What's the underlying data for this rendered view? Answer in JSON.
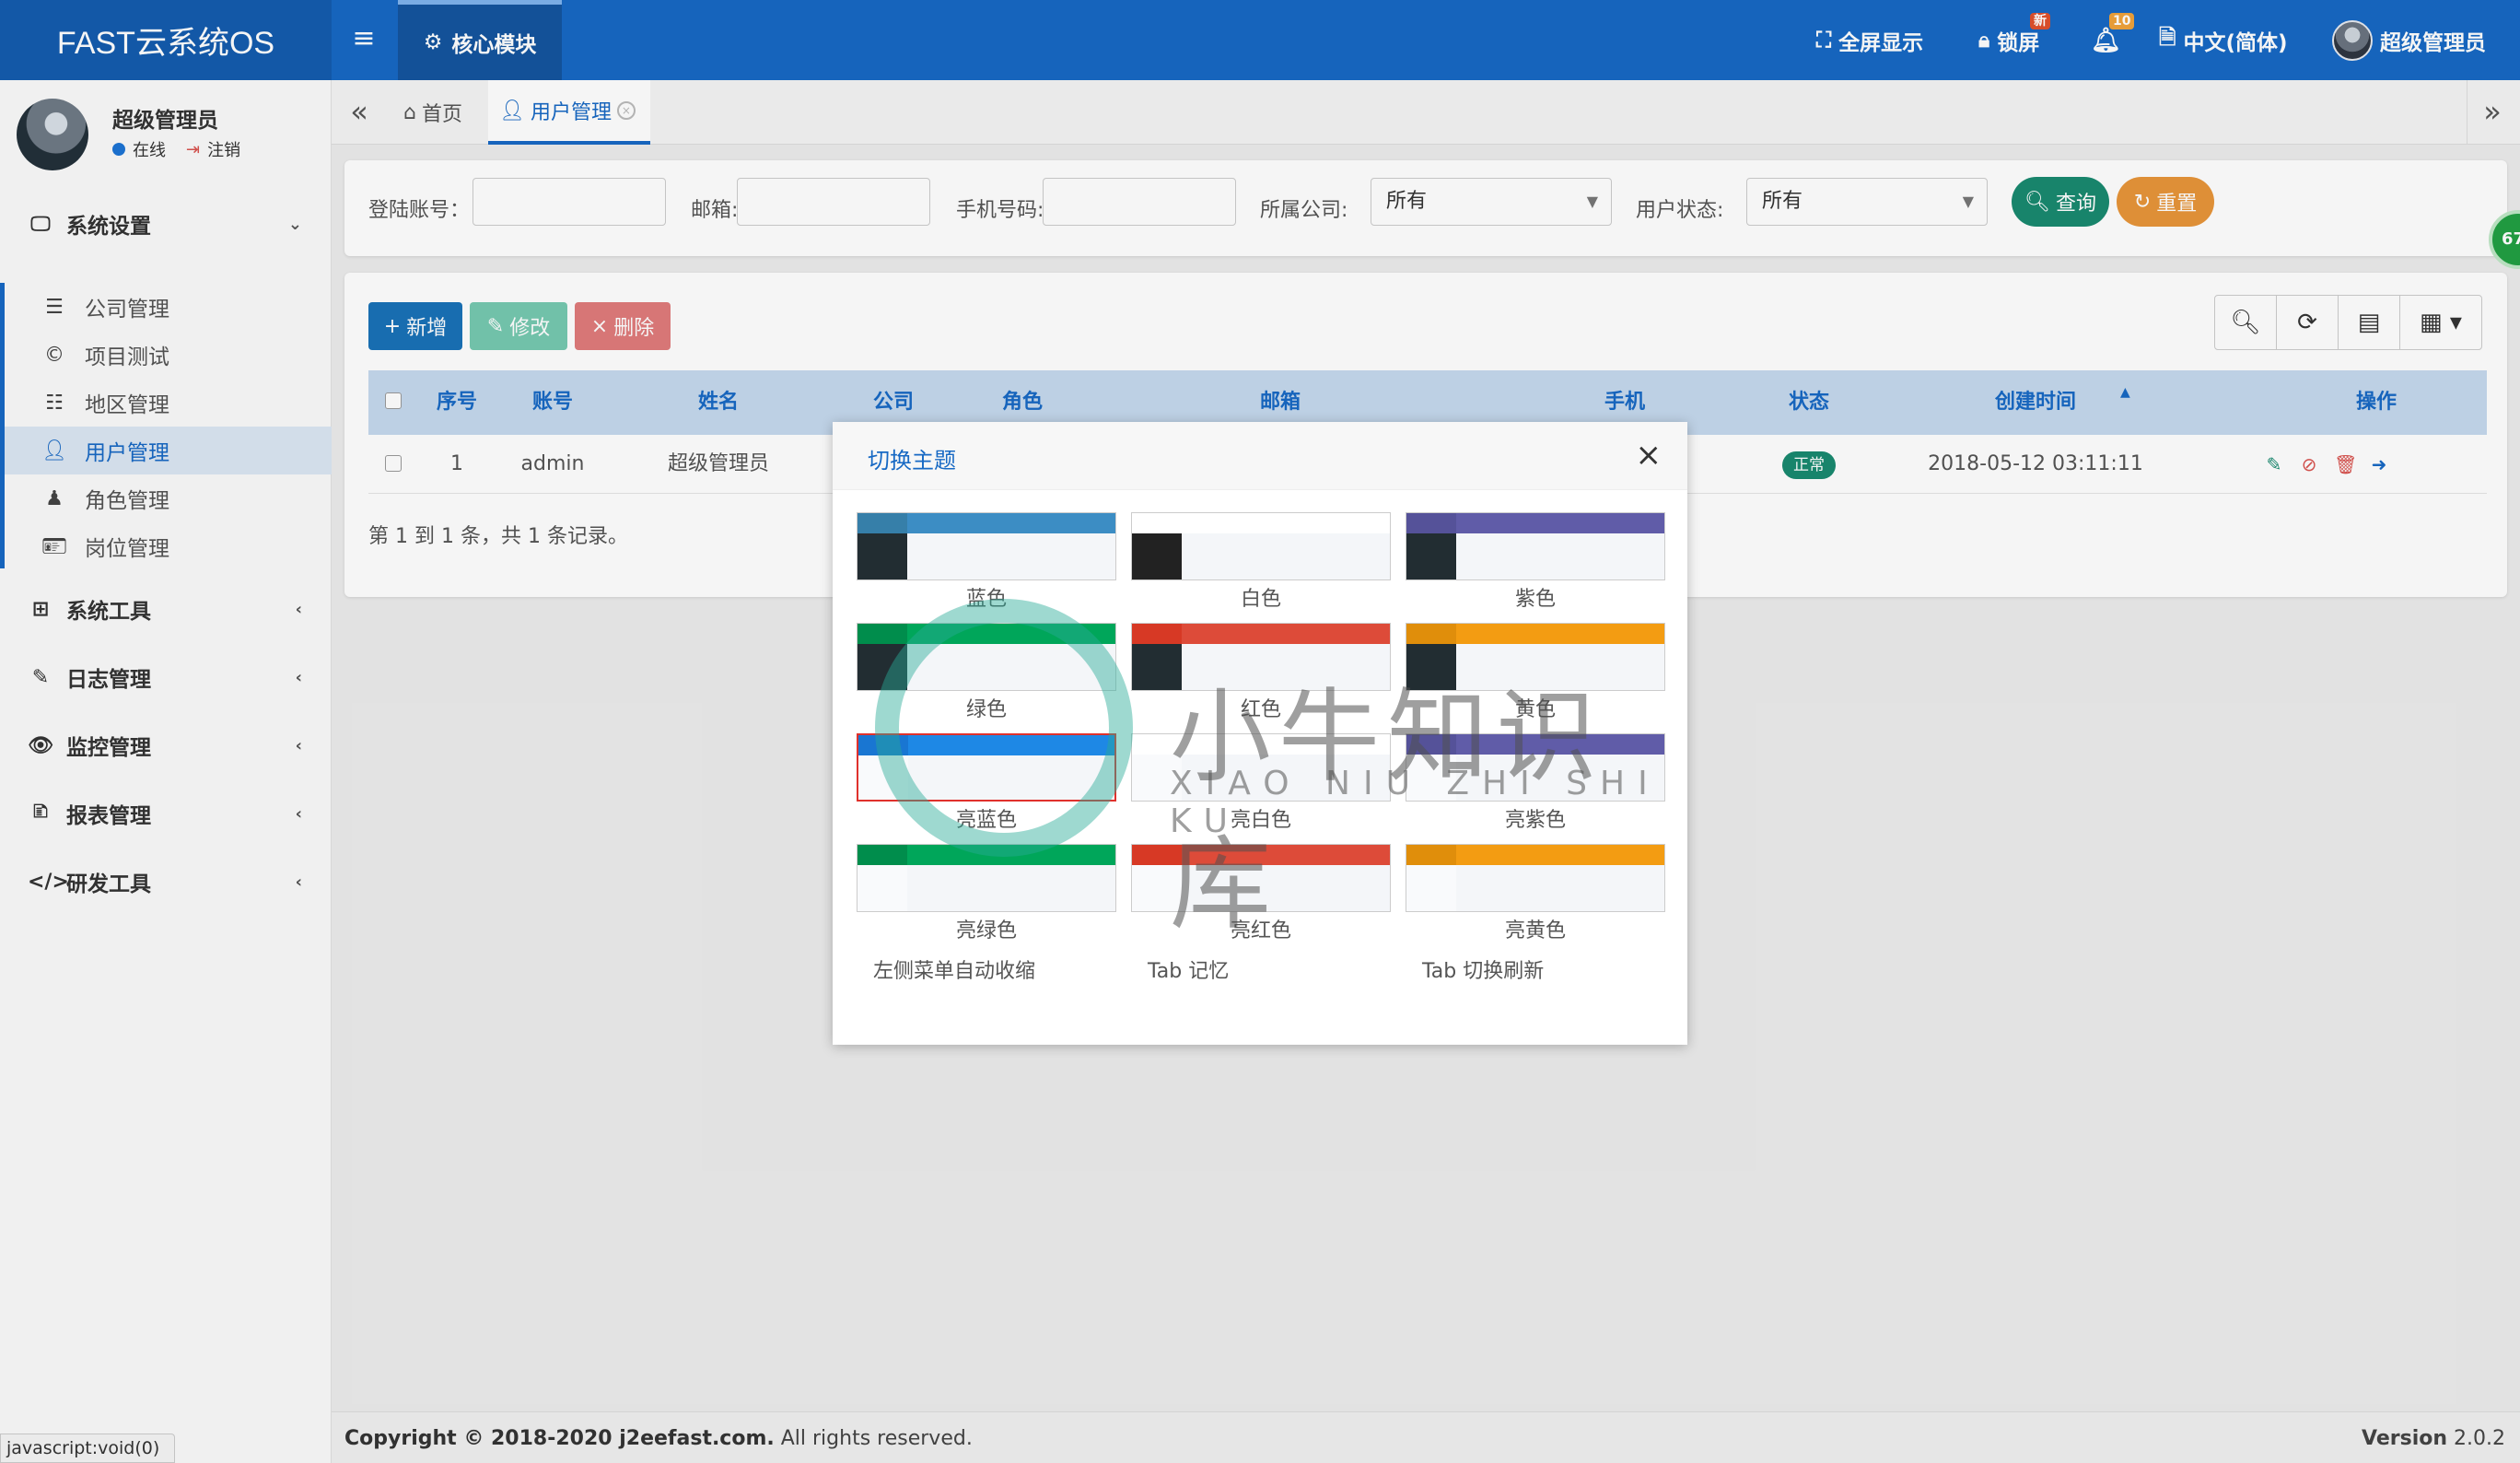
{
  "header": {
    "brand": "FAST云系统OS",
    "menu_toggle": "≡",
    "core_module": "核心模块",
    "fullscreen": "全屏显示",
    "lock": "锁屏",
    "lock_badge": "新",
    "notify_badge": "10",
    "language": "中文(简体)",
    "user": "超级管理员"
  },
  "sidebar": {
    "username": "超级管理员",
    "online": "在线",
    "logout": "注销",
    "groups": [
      {
        "label": "系统设置",
        "icon": "monitor-icon"
      },
      {
        "label": "系统工具",
        "icon": "windows-icon"
      },
      {
        "label": "日志管理",
        "icon": "edit-icon"
      },
      {
        "label": "监控管理",
        "icon": "eye-icon"
      },
      {
        "label": "报表管理",
        "icon": "report-icon"
      },
      {
        "label": "研发工具",
        "icon": "code-icon"
      }
    ],
    "sub_items": [
      {
        "label": "公司管理",
        "icon": "list-icon"
      },
      {
        "label": "项目测试",
        "icon": "copyright-icon"
      },
      {
        "label": "地区管理",
        "icon": "table-list-icon"
      },
      {
        "label": "用户管理",
        "icon": "user-icon"
      },
      {
        "label": "角色管理",
        "icon": "role-icon"
      },
      {
        "label": "岗位管理",
        "icon": "id-card-icon"
      }
    ]
  },
  "tabs": {
    "home": "首页",
    "users": "用户管理"
  },
  "search": {
    "login_account_label": "登陆账号：",
    "email_label": "邮箱:",
    "phone_label": "手机号码:",
    "company_label": "所属公司:",
    "company_value": "所有",
    "status_label": "用户状态:",
    "status_value": "所有",
    "query": "查询",
    "reset": "重置"
  },
  "toolbar": {
    "add": "新增",
    "edit": "修改",
    "delete": "删除"
  },
  "table": {
    "columns": [
      "序号",
      "账号",
      "姓名",
      "公司",
      "角色",
      "邮箱",
      "手机",
      "状态",
      "创建时间",
      "操作"
    ],
    "rows": [
      {
        "index": "1",
        "account": "admin",
        "name": "超级管理员",
        "status": "正常",
        "created": "2018-05-12 03:11:11"
      }
    ],
    "pagination": "第 1 到 1 条，共 1 条记录。"
  },
  "modal": {
    "title": "切换主题",
    "themes": [
      {
        "label": "蓝色",
        "top": "#3c8dc4",
        "topl": "#367fa9",
        "side": "#222d32"
      },
      {
        "label": "白色",
        "top": "#ffffff",
        "topl": "#ffffff",
        "side": "#222222"
      },
      {
        "label": "紫色",
        "top": "#605ca8",
        "topl": "#555299",
        "side": "#222d32"
      },
      {
        "label": "绿色",
        "top": "#00a65a",
        "topl": "#008d4c",
        "side": "#222d32"
      },
      {
        "label": "红色",
        "top": "#dd4b39",
        "topl": "#d73925",
        "side": "#222d32"
      },
      {
        "label": "黄色",
        "top": "#f39c12",
        "topl": "#e08e0b",
        "side": "#222d32"
      },
      {
        "label": "亮蓝色",
        "top": "#1e88e5",
        "topl": "#1976d2",
        "side": "#f9fafc"
      },
      {
        "label": "亮白色",
        "top": "#ffffff",
        "topl": "#ffffff",
        "side": "#f9fafc"
      },
      {
        "label": "亮紫色",
        "top": "#605ca8",
        "topl": "#555299",
        "side": "#f9fafc"
      },
      {
        "label": "亮绿色",
        "top": "#00a65a",
        "topl": "#008d4c",
        "side": "#f9fafc"
      },
      {
        "label": "亮红色",
        "top": "#dd4b39",
        "topl": "#d73925",
        "side": "#f9fafc"
      },
      {
        "label": "亮黄色",
        "top": "#f39c12",
        "topl": "#e08e0b",
        "side": "#f9fafc"
      }
    ],
    "selected_theme": "亮蓝色",
    "options": [
      "左侧菜单自动收缩",
      "Tab 记忆",
      "Tab 切换刷新"
    ]
  },
  "watermark": {
    "title": "小牛知识库",
    "subtitle": "XIAO NIU ZHI SHI KU"
  },
  "footer": {
    "copyright_prefix": "Copyright © 2018-2020 j2eefast.com.",
    "copyright_suffix": " All rights reserved.",
    "version_label": "Version",
    "version_value": "2.0.2"
  },
  "statusbar": "javascript:void(0)",
  "float_badge": "67",
  "colors": {
    "header": "#1769c4",
    "accent": "#1769c4",
    "query": "#1a8a70",
    "reset": "#e8953a",
    "add": "#1a72b8",
    "edit": "#76c9b0",
    "delete": "#e07b7b"
  }
}
